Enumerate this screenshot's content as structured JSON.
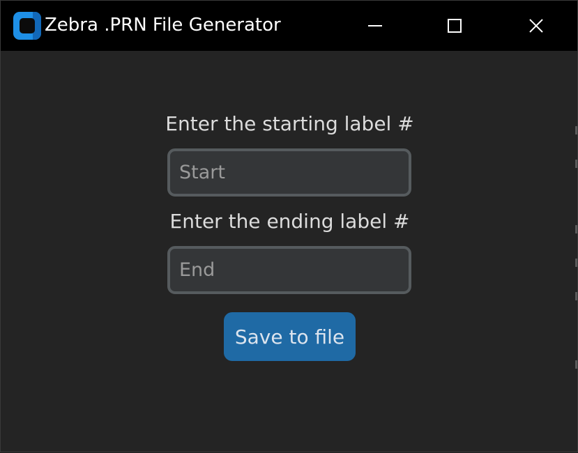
{
  "window": {
    "title": "Zebra .PRN File Generator",
    "controls": {
      "minimize_icon": "minimize-icon",
      "maximize_icon": "maximize-icon",
      "close_icon": "close-icon"
    }
  },
  "form": {
    "start_label": "Enter the starting label #",
    "start_placeholder": "Start",
    "start_value": "",
    "end_label": "Enter the ending label #",
    "end_placeholder": "End",
    "end_value": "",
    "save_button_label": "Save to file"
  },
  "colors": {
    "titlebar": "#000000",
    "background": "#242424",
    "input_bg": "#343638",
    "input_border": "#565b5e",
    "button": "#1f6aa5",
    "app_icon": "#1e8fe6"
  }
}
